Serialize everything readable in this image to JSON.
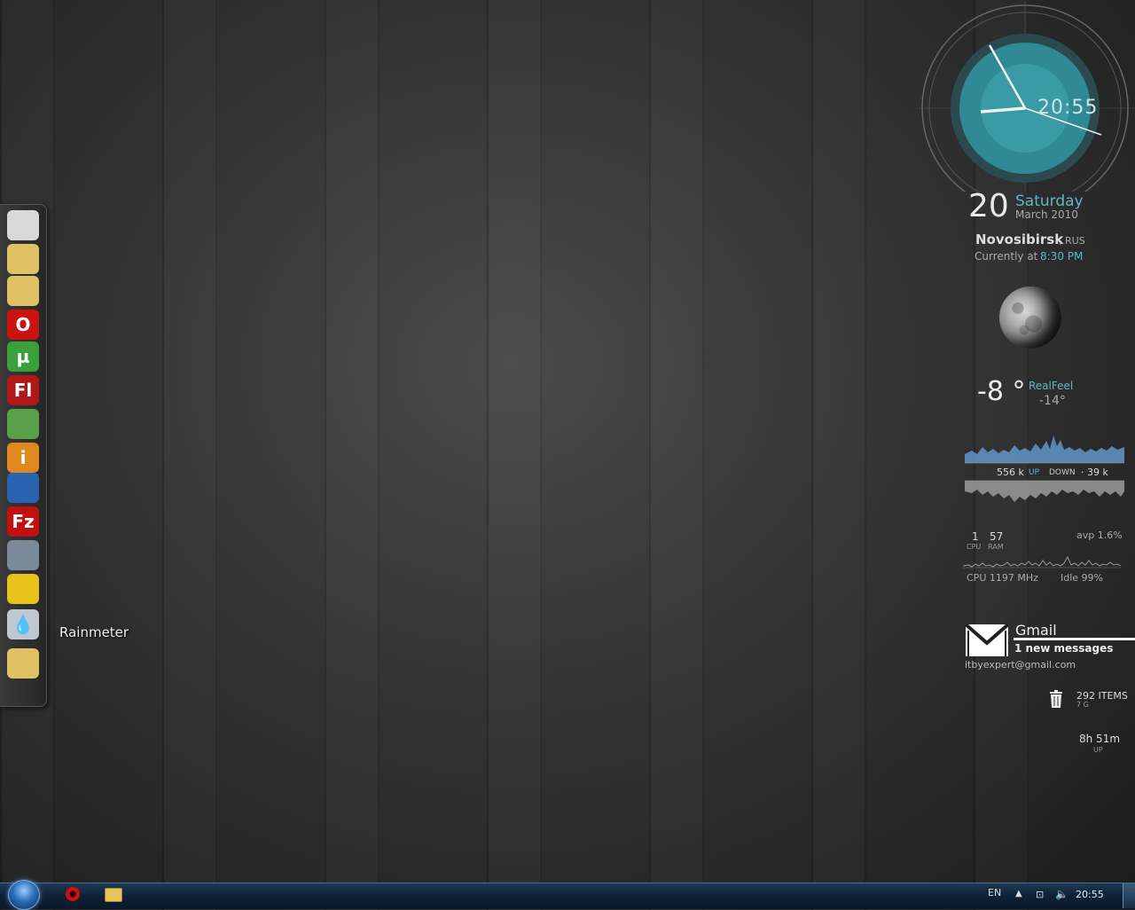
{
  "dock": {
    "items": [
      {
        "name": "computer-icon",
        "color": "#d8d8d8",
        "glyph": ""
      },
      {
        "name": "documents-folder-icon",
        "color": "#e0c264",
        "glyph": ""
      },
      {
        "name": "media-folder-icon",
        "color": "#e0c264",
        "glyph": ""
      },
      {
        "name": "opera-icon",
        "color": "#cc1111",
        "glyph": "O"
      },
      {
        "name": "utorrent-icon",
        "color": "#3aa03a",
        "glyph": "µ"
      },
      {
        "name": "flash-icon",
        "color": "#b01818",
        "glyph": "Fl"
      },
      {
        "name": "archive-icon",
        "color": "#5aa04a",
        "glyph": ""
      },
      {
        "name": "info-icon",
        "color": "#e08820",
        "glyph": "i"
      },
      {
        "name": "network-icon",
        "color": "#2a64b0",
        "glyph": ""
      },
      {
        "name": "filezilla-icon",
        "color": "#c01010",
        "glyph": "Fz"
      },
      {
        "name": "scanner-icon",
        "color": "#7a8a9a",
        "glyph": ""
      },
      {
        "name": "webcam-icon",
        "color": "#e6c21a",
        "glyph": ""
      },
      {
        "name": "rainmeter-icon",
        "color": "#bfc8d2",
        "glyph": "💧"
      },
      {
        "name": "folder-icon",
        "color": "#e0c264",
        "glyph": ""
      }
    ],
    "tooltip": "Rainmeter"
  },
  "clock": {
    "time": "20:55"
  },
  "date": {
    "day": "20",
    "weekday": "Saturday",
    "month_year": "March 2010"
  },
  "weather": {
    "city": "Novosibirsk",
    "country": ", RUS",
    "currently_label": "Currently at",
    "currently_time": "8:30 PM",
    "temp": "-8 °",
    "realfeel_label": "RealFeel",
    "realfeel_value": "-14°"
  },
  "network": {
    "up_value": "556 k",
    "up_label": "UP",
    "down_label": "DOWN",
    "down_value": "· 39 k"
  },
  "system": {
    "cpu_value": "1",
    "cpu_label": "CPU",
    "ram_value": "57",
    "ram_label": "RAM",
    "avp": "avp 1.6%",
    "cpu_mhz": "CPU 1197 MHz",
    "idle": "Idle 99%"
  },
  "gmail": {
    "title": "Gmail",
    "messages": "1 new messages",
    "email": "itbyexpert@gmail.com"
  },
  "recycle": {
    "items": "292 ITEMS",
    "size": "7 G"
  },
  "uptime": {
    "value": "8h 51m",
    "label": "UP"
  },
  "taskbar": {
    "lang": "EN",
    "arrow": "▲",
    "clock": "20:55"
  },
  "colors": {
    "accent": "#5fb6c4",
    "clock_face": "#2f8a95"
  }
}
